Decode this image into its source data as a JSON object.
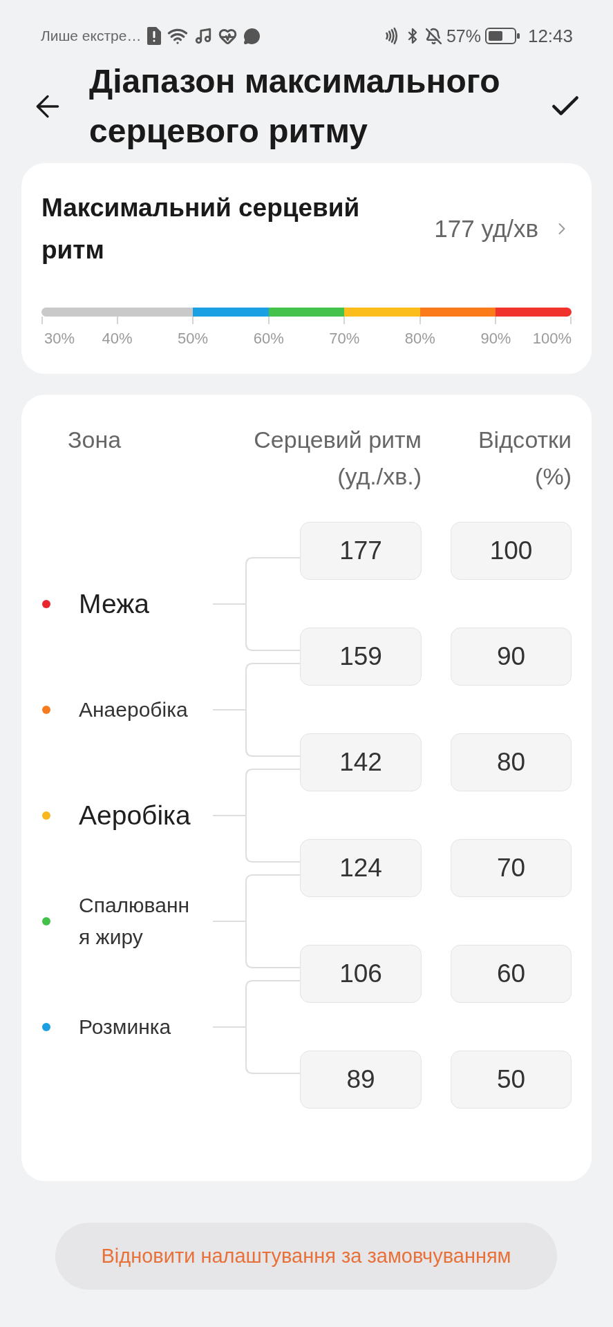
{
  "status_bar": {
    "notification": "Лише екстре…",
    "battery": "57%",
    "time": "12:43"
  },
  "header": {
    "title": "Діапазон максимального серцевого ритму"
  },
  "max_heart_rate": {
    "label": "Максимальний серцевий ритм",
    "value": "177 уд/хв",
    "scale": {
      "segments": [
        {
          "color": "#c9c9c9"
        },
        {
          "color": "#c9c9c9"
        },
        {
          "color": "#1aa0e3"
        },
        {
          "color": "#44c24b"
        },
        {
          "color": "#fbbd1b"
        },
        {
          "color": "#fb7b1b"
        },
        {
          "color": "#f1332e"
        }
      ],
      "ticks": [
        "30%",
        "40%",
        "50%",
        "60%",
        "70%",
        "80%",
        "90%",
        "100%"
      ]
    }
  },
  "zones_table": {
    "columns": [
      "Зона",
      "Серцевий ритм (уд./хв.)",
      "Відсотки (%)"
    ],
    "zones": [
      {
        "name": "Межа",
        "color": "#e8262d",
        "emphasized": true
      },
      {
        "name": "Анаеробіка",
        "color": "#f57b20",
        "emphasized": false
      },
      {
        "name": "Аеробіка",
        "color": "#f8b71c",
        "emphasized": true
      },
      {
        "name": "Спалювання жиру",
        "color": "#43c14b",
        "emphasized": false
      },
      {
        "name": "Розминка",
        "color": "#1b9fe2",
        "emphasized": false
      }
    ],
    "bounds": [
      {
        "bpm": "177",
        "percent": "100"
      },
      {
        "bpm": "159",
        "percent": "90"
      },
      {
        "bpm": "142",
        "percent": "80"
      },
      {
        "bpm": "124",
        "percent": "70"
      },
      {
        "bpm": "106",
        "percent": "60"
      },
      {
        "bpm": "89",
        "percent": "50"
      }
    ]
  },
  "reset_button": {
    "label": "Відновити налаштування за замовчуванням"
  }
}
